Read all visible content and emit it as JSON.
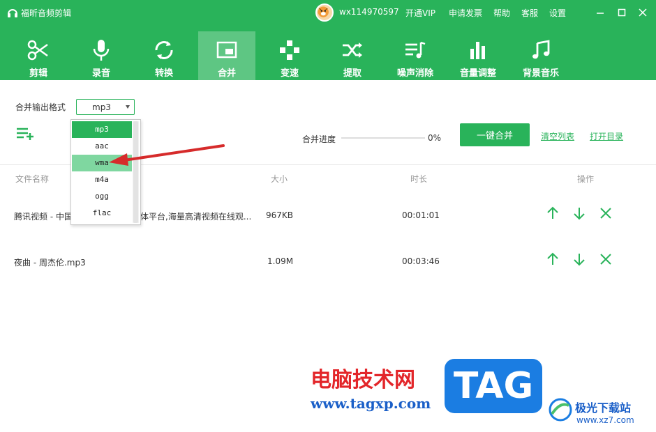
{
  "app": {
    "title": "福昕音频剪辑"
  },
  "header": {
    "username": "wx114970597",
    "links": [
      "开通VIP",
      "申请发票",
      "帮助",
      "客服",
      "设置"
    ]
  },
  "toolbar": {
    "items": [
      {
        "label": "剪辑",
        "icon": "scissors-icon"
      },
      {
        "label": "录音",
        "icon": "microphone-icon"
      },
      {
        "label": "转换",
        "icon": "convert-icon"
      },
      {
        "label": "合并",
        "icon": "merge-icon",
        "active": true
      },
      {
        "label": "变速",
        "icon": "speed-icon"
      },
      {
        "label": "提取",
        "icon": "extract-icon"
      },
      {
        "label": "噪声消除",
        "icon": "denoise-icon"
      },
      {
        "label": "音量调整",
        "icon": "volume-icon"
      },
      {
        "label": "背景音乐",
        "icon": "music-note-icon"
      }
    ]
  },
  "controls": {
    "format_label": "合并输出格式",
    "format_value": "mp3",
    "format_options": [
      "mp3",
      "aac",
      "wma",
      "m4a",
      "ogg",
      "flac"
    ],
    "progress_label": "合并进度",
    "progress_percent": "0%",
    "progress_value": 0,
    "merge_button": "一键合并",
    "clear_link": "清空列表",
    "open_dir_link": "打开目录"
  },
  "table": {
    "headers": {
      "name": "文件名称",
      "size": "大小",
      "duration": "时长",
      "actions": "操作"
    },
    "rows": [
      {
        "name_start": "腾讯视频 - 中国",
        "name_end": "体平台,海量高清视频在线观...",
        "size": "967KB",
        "duration": "00:01:01"
      },
      {
        "name": "夜曲 - 周杰伦.mp3",
        "size": "1.09M",
        "duration": "00:03:46"
      }
    ]
  },
  "watermark": {
    "cn": "电脑技术网",
    "url": "www.tagxp.com",
    "badge": "TAG",
    "site_name": "极光下载站",
    "site_url": "www.xz7.com"
  },
  "colors": {
    "primary": "#29b35a",
    "hover_option": "#7fd7a0",
    "arrow": "#d62b2b"
  }
}
